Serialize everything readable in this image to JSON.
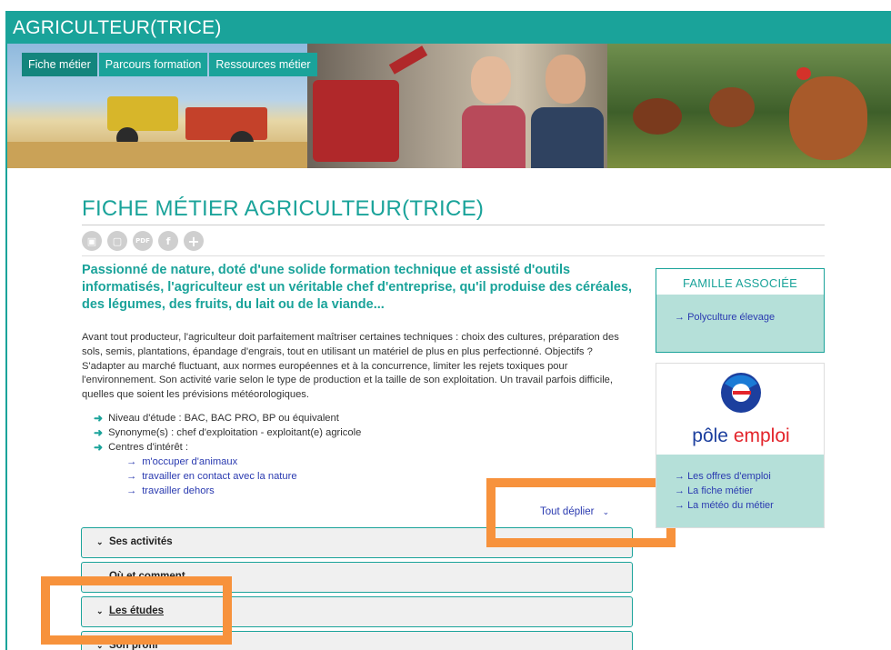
{
  "page_title": "AGRICULTEUR(TRICE)",
  "tabs": [
    "Fiche métier",
    "Parcours formation",
    "Ressources métier"
  ],
  "heading": "FICHE MÉTIER AGRICULTEUR(TRICE)",
  "share_icons": [
    "print-icon",
    "document-icon",
    "pdf-icon",
    "facebook-icon",
    "plus-icon"
  ],
  "lead": "Passionné de nature, doté d'une solide formation technique et assisté d'outils informatisés, l'agriculteur est un véritable chef d'entreprise, qu'il produise des céréales, des légumes, des fruits, du lait ou de la viande...",
  "description": "Avant tout producteur, l'agriculteur doit parfaitement maîtriser certaines techniques : choix des cultures, préparation des sols, semis, plantations, épandage d'engrais, tout en utilisant un matériel de plus en plus perfectionné. Objectifs ? S'adapter au marché fluctuant, aux normes européennes et à la concurrence, limiter les rejets toxiques pour l'environnement. Son activité varie selon le type de production et la taille de son exploitation. Un travail parfois difficile, quelles que soient les prévisions météorologiques.",
  "facts": {
    "niveau": "Niveau d'étude : BAC, BAC PRO, BP ou équivalent",
    "synonymes": "Synonyme(s) : chef d'exploitation - exploitant(e) agricole",
    "centres": "Centres d'intérêt :",
    "interests": [
      "m'occuper d'animaux",
      "travailler en contact avec la nature",
      "travailler dehors"
    ]
  },
  "expand_all": "Tout déplier",
  "accordion": [
    "Ses activités",
    "Où et comment",
    "Les études",
    "Son profil"
  ],
  "famille": {
    "title": "FAMILLE ASSOCIÉE",
    "link": "Polyculture élevage"
  },
  "pole_emploi": {
    "brand_a": "pôle",
    "brand_b": "emploi",
    "links": [
      "Les offres d'emploi",
      "La fiche métier",
      "La météo du métier"
    ]
  },
  "colors": {
    "accent": "#1aa39a",
    "highlight": "#f7923c",
    "link": "#2a3ab0"
  }
}
